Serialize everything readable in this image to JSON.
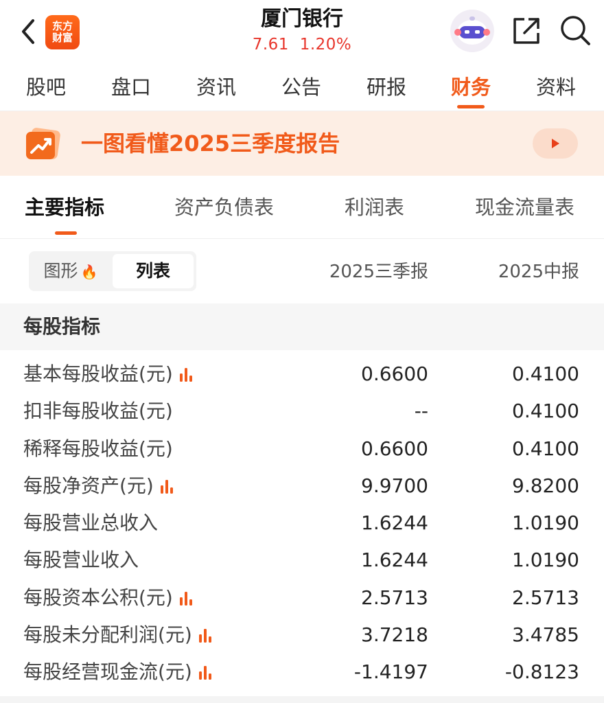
{
  "header": {
    "logo_line1": "东方",
    "logo_line2": "财富",
    "stock_name": "厦门银行",
    "price": "7.61",
    "change_pct": "1.20%",
    "icons": [
      "back-icon",
      "robot-assistant-icon",
      "share-icon",
      "search-icon"
    ]
  },
  "top_tabs": [
    {
      "label": "股吧"
    },
    {
      "label": "盘口"
    },
    {
      "label": "资讯"
    },
    {
      "label": "公告"
    },
    {
      "label": "研报"
    },
    {
      "label": "财务",
      "active": true
    },
    {
      "label": "资料"
    }
  ],
  "banner": {
    "text": "一图看懂2025三季度报告"
  },
  "sub_tabs": [
    {
      "label": "主要指标",
      "active": true
    },
    {
      "label": "资产负债表"
    },
    {
      "label": "利润表"
    },
    {
      "label": "现金流量表"
    }
  ],
  "view_toggle": {
    "chart_label": "图形",
    "list_label": "列表",
    "selected": "列表"
  },
  "columns": [
    "2025三季报",
    "2025中报"
  ],
  "section": {
    "title": "每股指标"
  },
  "rows": [
    {
      "label": "基本每股收益(元)",
      "has_chart": true,
      "v1": "0.6600",
      "v2": "0.4100"
    },
    {
      "label": "扣非每股收益(元)",
      "has_chart": false,
      "v1": "--",
      "v2": "0.4100"
    },
    {
      "label": "稀释每股收益(元)",
      "has_chart": false,
      "v1": "0.6600",
      "v2": "0.4100"
    },
    {
      "label": "每股净资产(元)",
      "has_chart": true,
      "v1": "9.9700",
      "v2": "9.8200"
    },
    {
      "label": "每股营业总收入",
      "has_chart": false,
      "v1": "1.6244",
      "v2": "1.0190"
    },
    {
      "label": "每股营业收入",
      "has_chart": false,
      "v1": "1.6244",
      "v2": "1.0190"
    },
    {
      "label": "每股资本公积(元)",
      "has_chart": true,
      "v1": "2.5713",
      "v2": "2.5713"
    },
    {
      "label": "每股未分配利润(元)",
      "has_chart": true,
      "v1": "3.7218",
      "v2": "3.4785"
    },
    {
      "label": "每股经营现金流(元)",
      "has_chart": true,
      "v1": "-1.4197",
      "v2": "-0.8123"
    }
  ],
  "colors": {
    "accent": "#f15a1a",
    "price_up": "#e8352b",
    "banner_bg": "#fdeee4"
  }
}
